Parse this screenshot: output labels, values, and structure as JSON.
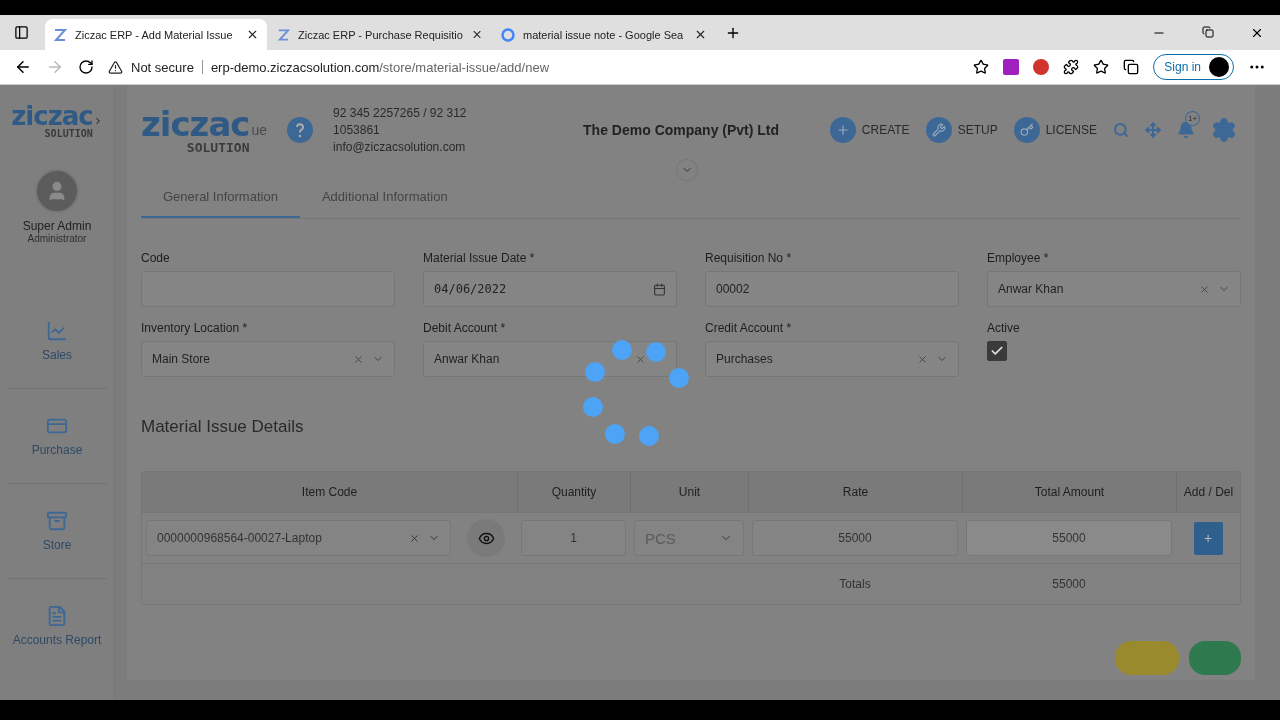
{
  "browser": {
    "tabs": [
      {
        "title": "Ziczac ERP - Add Material Issue",
        "selected": true
      },
      {
        "title": "Ziczac ERP - Purchase Requisitio",
        "selected": false
      },
      {
        "title": "material issue note - Google Sea",
        "selected": false
      }
    ],
    "security": "Not secure",
    "url": "erp-demo.ziczacsolution.com",
    "path": "/store/material-issue/add/new",
    "sign_in": "Sign in"
  },
  "sidebar": {
    "logo": {
      "word": "ziczac",
      "sub": "SOLUTION"
    },
    "user": {
      "name": "Super Admin",
      "role": "Administrator"
    },
    "items": [
      {
        "label": "Sales"
      },
      {
        "label": "Purchase"
      },
      {
        "label": "Store"
      },
      {
        "label": "Accounts Report"
      }
    ]
  },
  "header": {
    "logo": {
      "word": "ziczac",
      "sub": "SOLUTION"
    },
    "title_fragment": "ue",
    "contact": [
      "92 345 2257265 / 92 312",
      "1053861",
      "info@ziczacsolution.com"
    ],
    "company": "The Demo Company (Pvt) Ltd",
    "actions": [
      {
        "label": "CREATE"
      },
      {
        "label": "SETUP"
      },
      {
        "label": "LICENSE"
      }
    ],
    "notification_badge": "1+"
  },
  "tabs": [
    {
      "label": "General Information",
      "selected": true
    },
    {
      "label": "Additional Information",
      "selected": false
    }
  ],
  "fields": [
    {
      "kind": "text",
      "label": "Code"
    },
    {
      "kind": "date",
      "label": "Material Issue Date *",
      "value": "04/06/2022"
    },
    {
      "kind": "text",
      "label": "Requisition No *",
      "value": "00002"
    },
    {
      "kind": "select",
      "label": "Employee *",
      "value": "Anwar Khan"
    },
    {
      "kind": "select",
      "label": "Inventory Location *",
      "value": "Main Store"
    },
    {
      "kind": "select",
      "label": "Debit Account *",
      "value": "Anwar Khan"
    },
    {
      "kind": "select",
      "label": "Credit Account *",
      "value": "Purchases"
    },
    {
      "kind": "checkbox",
      "label": "Active",
      "checked": true
    }
  ],
  "section_title": "Material Issue Details",
  "table": {
    "columns": [
      "Item Code",
      "Quantity",
      "Unit",
      "Rate",
      "Total Amount",
      "Add / Del"
    ],
    "rows": [
      {
        "item_code": "0000000968564-00027-Laptop",
        "quantity": "1",
        "unit": "PCS",
        "rate": "55000",
        "total_amount": "55000",
        "action": "+"
      }
    ],
    "totals_label": "Totals",
    "totals_value": "55000"
  },
  "loading": true
}
